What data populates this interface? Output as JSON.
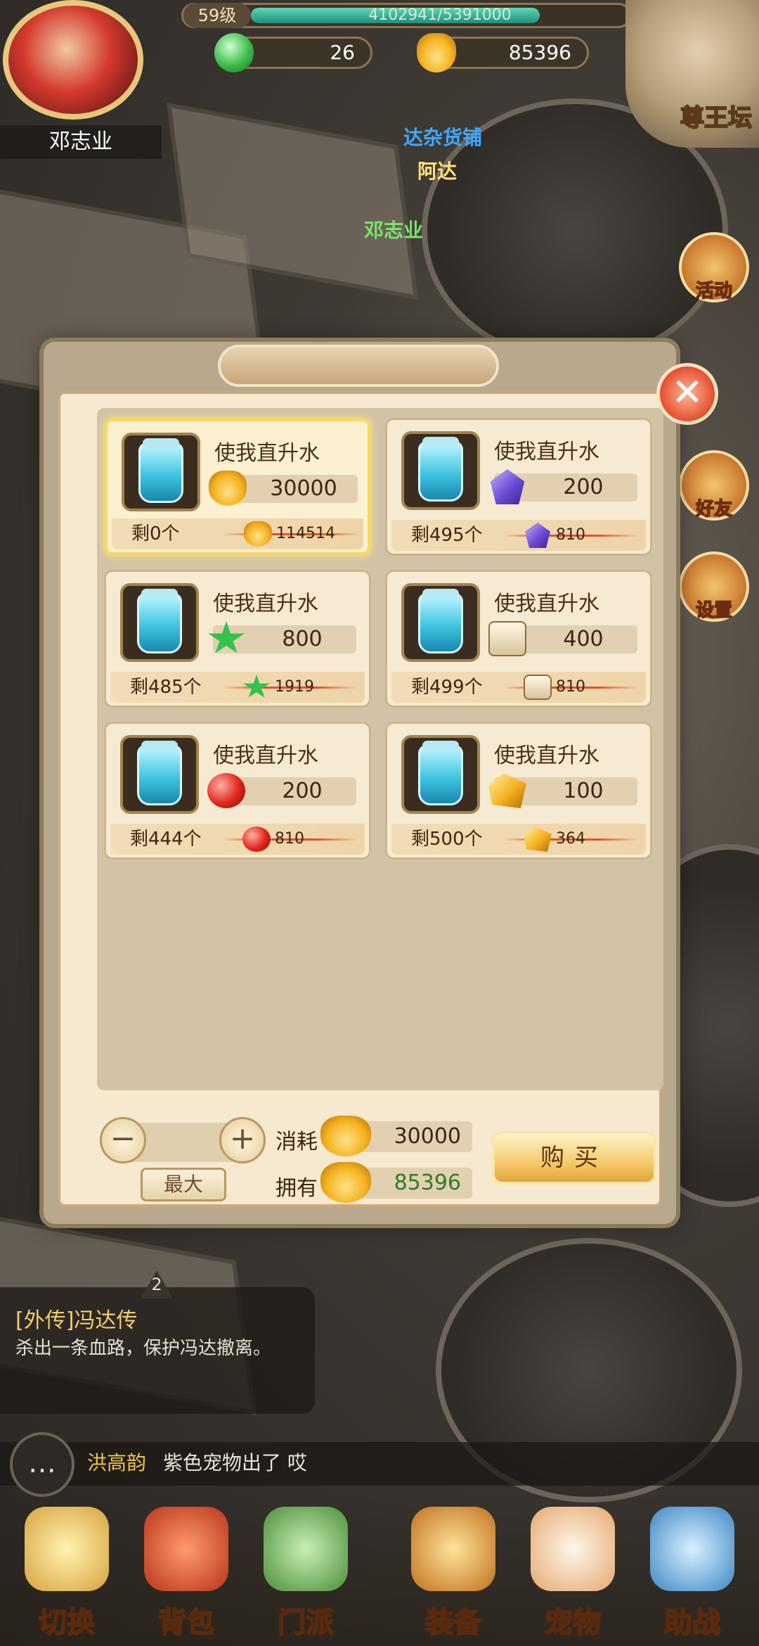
{
  "hud": {
    "player_name": "邓志业",
    "level": "59级",
    "exp_text": "4102941/5391000",
    "exp_fraction": 0.761,
    "currency_jade": "26",
    "currency_gold": "85396",
    "altar_label": "尊王坛"
  },
  "scene": {
    "shop_npc": "达杂货铺",
    "npc_name": "阿达",
    "player_tag": "邓志业"
  },
  "side_buttons": [
    {
      "label": "活动",
      "icon": "activity-icon"
    },
    {
      "label": "好友",
      "icon": "friends-icon"
    },
    {
      "label": "设置",
      "icon": "settings-icon"
    }
  ],
  "shop": {
    "close_label": "✕",
    "items": [
      {
        "name": "使我直升水",
        "price_icon": "gold-ingot-icon",
        "price": "30000",
        "stock": "剩0个",
        "orig_icon": "gold-ingot-icon",
        "orig_price": "114514",
        "selected": true
      },
      {
        "name": "使我直升水",
        "price_icon": "purple-gem-icon",
        "price": "200",
        "stock": "剩495个",
        "orig_icon": "purple-gem-icon",
        "orig_price": "810",
        "selected": false
      },
      {
        "name": "使我直升水",
        "price_icon": "green-star-icon",
        "price": "800",
        "stock": "剩485个",
        "orig_icon": "green-star-icon",
        "orig_price": "1919",
        "selected": false
      },
      {
        "name": "使我直升水",
        "price_icon": "paw-scroll-icon",
        "price": "400",
        "stock": "剩499个",
        "orig_icon": "paw-scroll-icon",
        "orig_price": "810",
        "selected": false
      },
      {
        "name": "使我直升水",
        "price_icon": "red-orb-icon",
        "price": "200",
        "stock": "剩444个",
        "orig_icon": "red-orb-icon",
        "orig_price": "810",
        "selected": false
      },
      {
        "name": "使我直升水",
        "price_icon": "gold-crystal-icon",
        "price": "100",
        "stock": "剩500个",
        "orig_icon": "gold-crystal-icon",
        "orig_price": "364",
        "selected": false
      }
    ],
    "quantity": {
      "minus_label": "−",
      "plus_label": "+",
      "max_label": "最大"
    },
    "cost_label": "消耗",
    "cost_value": "30000",
    "own_label": "拥有",
    "own_value": "85396",
    "buy_label": "购买"
  },
  "quest": {
    "badge": "2",
    "title": "[外传]冯达传",
    "desc": "杀出一条血路，保护冯达撤离。"
  },
  "chat": {
    "sender": "洪高韵",
    "message": "紫色宠物出了 哎"
  },
  "bottom_nav": [
    {
      "label": "切换"
    },
    {
      "label": "背包"
    },
    {
      "label": "门派"
    },
    {
      "label": "装备"
    },
    {
      "label": "宠物"
    },
    {
      "label": "助战"
    }
  ],
  "colors": {
    "gold_text": "#f1cf6a",
    "own_value": "#2f7a2f",
    "panel_bg": "#f6e9cf"
  }
}
